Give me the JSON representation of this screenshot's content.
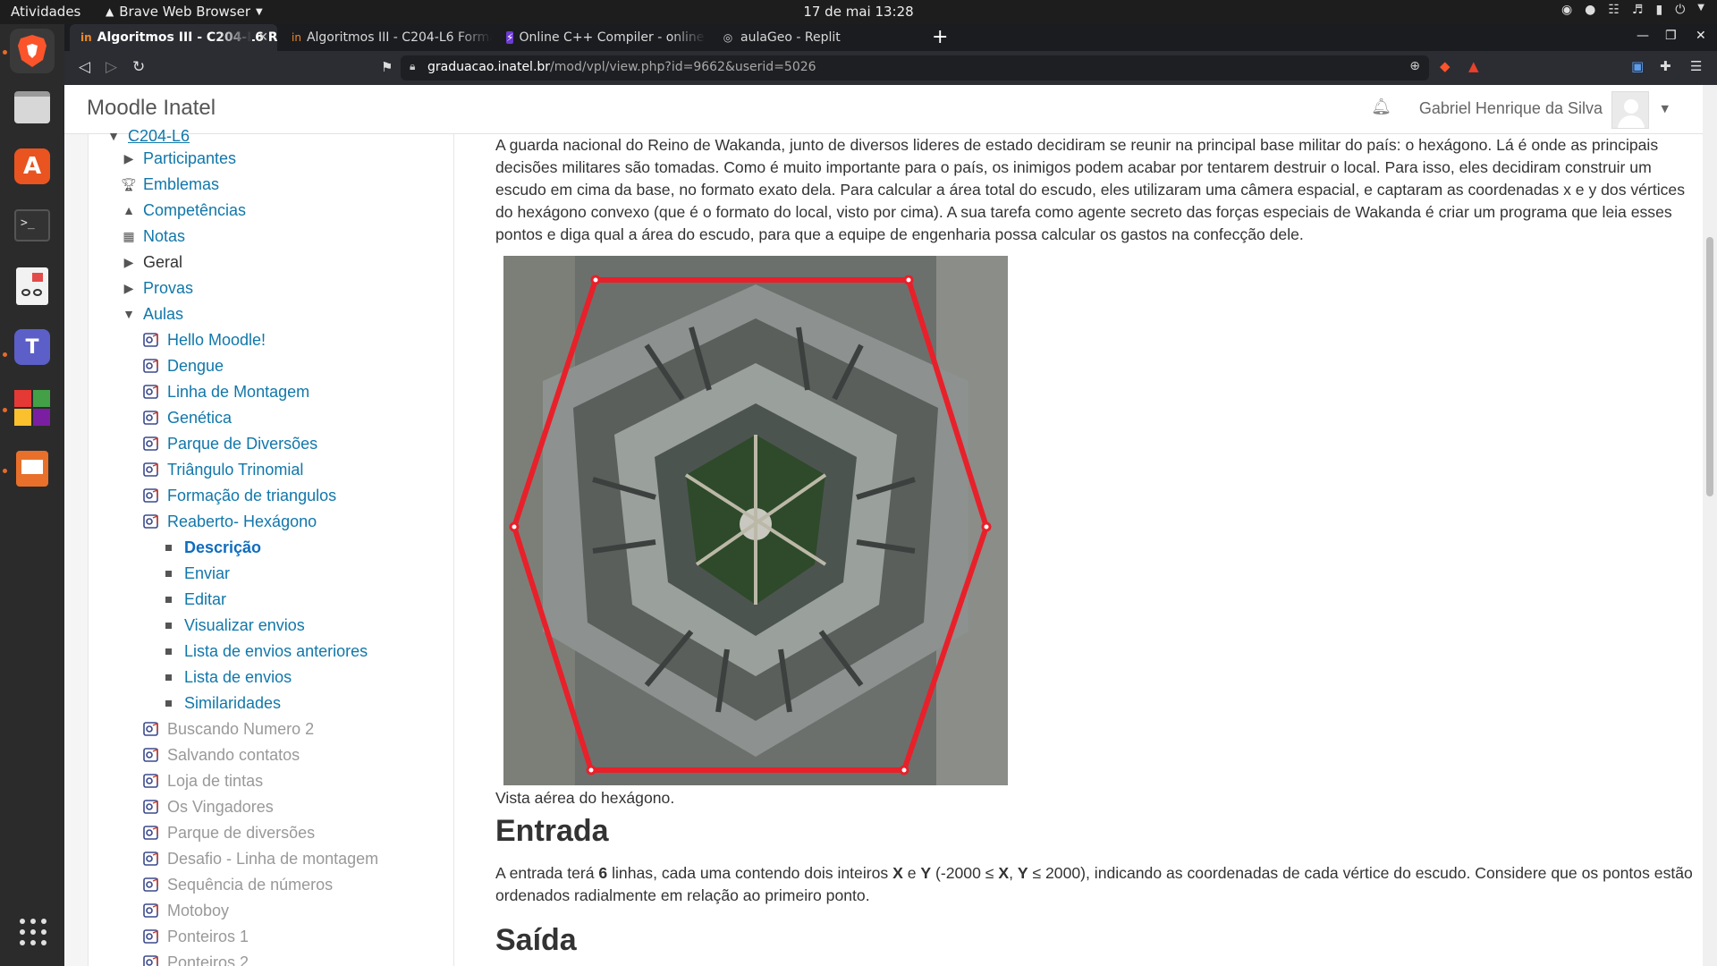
{
  "topbar": {
    "activities": "Atividades",
    "app_menu": "Brave Web Browser",
    "clock": "17 de mai  13:28"
  },
  "dock": {
    "apps": [
      "brave-icon",
      "files-icon",
      "app-center-icon",
      "terminal-icon",
      "document-viewer-icon",
      "teams-icon",
      "office-icon",
      "presentation-icon",
      "show-apps-icon"
    ]
  },
  "browser": {
    "tabs": [
      {
        "label": "Algoritmos III - C204-L6 Re",
        "active": true
      },
      {
        "label": "Algoritmos III - C204-L6 Forma"
      },
      {
        "label": "Online C++ Compiler - online e"
      },
      {
        "label": "aulaGeo - Replit"
      }
    ],
    "url": {
      "domain": "graduacao.inatel.br",
      "path": "/mod/vpl/view.php?id=9662&userid=5026"
    }
  },
  "header": {
    "site_name": "Moodle Inatel",
    "user_name": "Gabriel Henrique da Silva"
  },
  "nav": {
    "course": "C204-L6",
    "items": [
      {
        "label": "Participantes"
      },
      {
        "label": "Emblemas"
      },
      {
        "label": "Competências"
      },
      {
        "label": "Notas"
      },
      {
        "label": "Geral"
      },
      {
        "label": "Provas"
      },
      {
        "label": "Aulas"
      }
    ],
    "aulas": [
      "Hello Moodle!",
      "Dengue",
      "Linha de Montagem",
      "Genética",
      "Parque de Diversões",
      "Triângulo Trinomial",
      "Formação de triangulos",
      "Reaberto- Hexágono"
    ],
    "subitems": [
      "Descrição",
      "Enviar",
      "Editar",
      "Visualizar envios",
      "Lista de envios anteriores",
      "Lista de envios",
      "Similaridades"
    ],
    "hidden_activities": [
      "Buscando Numero 2",
      "Salvando contatos",
      "Loja de tintas",
      "Os Vingadores",
      "Parque de diversões",
      "Desafio - Linha de montagem",
      "Sequência de números",
      "Motoboy",
      "Ponteiros 1",
      "Ponteiros 2"
    ]
  },
  "content": {
    "description": "A guarda nacional do Reino de Wakanda, junto de diversos lideres de estado decidiram se reunir na principal base militar do país: o hexágono. Lá é onde as principais decisões militares são tomadas. Como é muito importante para o país, os inimigos podem acabar por tentarem destruir o local. Para isso, eles decidiram construir um escudo em cima da base, no formato exato dela. Para calcular a área total do escudo, eles utilizaram uma câmera espacial, e captaram as coordenadas x e y dos vértices do hexágono convexo (que é o formato do local, visto por cima). A sua tarefa como agente secreto das forças especiais de Wakanda é criar um programa que leia esses pontos e diga qual a área do escudo, para que a equipe de engenharia possa calcular os gastos na confecção dele.",
    "caption": "Vista aérea do hexágono.",
    "entrada_title": "Entrada",
    "entrada": {
      "p1": "A entrada terá ",
      "n": "6",
      "p2": " linhas, cada uma contendo dois inteiros ",
      "x": "X",
      "p3": " e ",
      "y": "Y",
      "p4": " (-2000 ≤ ",
      "x2": "X",
      "p5": ", ",
      "y2": "Y",
      "p6": " ≤ 2000), indicando as coordenadas de cada vértice do escudo. Considere que os pontos estão ordenados radialmente em relação ao primeiro ponto."
    },
    "saida_title": "Saída"
  },
  "colors": {
    "link": "#1177aa",
    "shield": "#e8202a",
    "topbar": "#1d1d1d"
  }
}
